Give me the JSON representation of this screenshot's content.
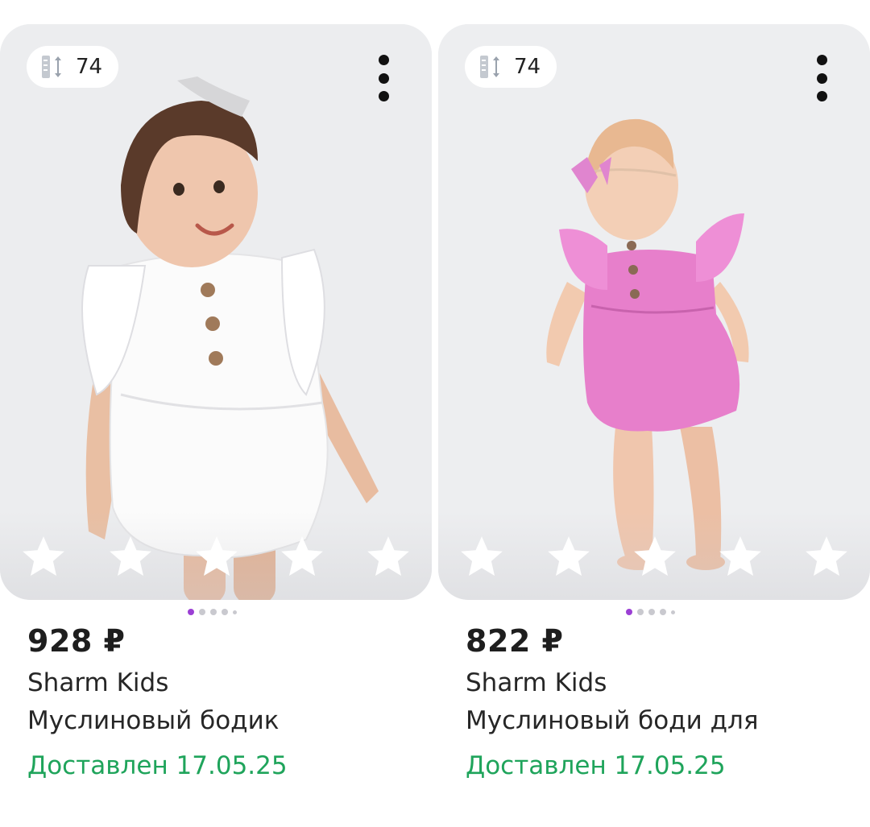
{
  "products": [
    {
      "size_badge": "74",
      "price": "928 ₽",
      "brand": "Sharm Kids",
      "name": "Муслиновый бодик",
      "delivery_status": "Доставлен 17.05.25",
      "rating_stars": 5,
      "photo_pages": 5,
      "active_page": 1,
      "garment_color": "#ffffff"
    },
    {
      "size_badge": "74",
      "price": "822 ₽",
      "brand": "Sharm Kids",
      "name": "Муслиновый боди для",
      "delivery_status": "Доставлен 17.05.25",
      "rating_stars": 5,
      "photo_pages": 5,
      "active_page": 1,
      "garment_color": "#e985cf"
    }
  ],
  "colors": {
    "delivered": "#1fa45b",
    "pager_active": "#9b3fd4",
    "photo_bg": "#eceef0"
  },
  "icons": [
    "size-ruler-icon",
    "more-vertical-icon",
    "star-icon"
  ]
}
